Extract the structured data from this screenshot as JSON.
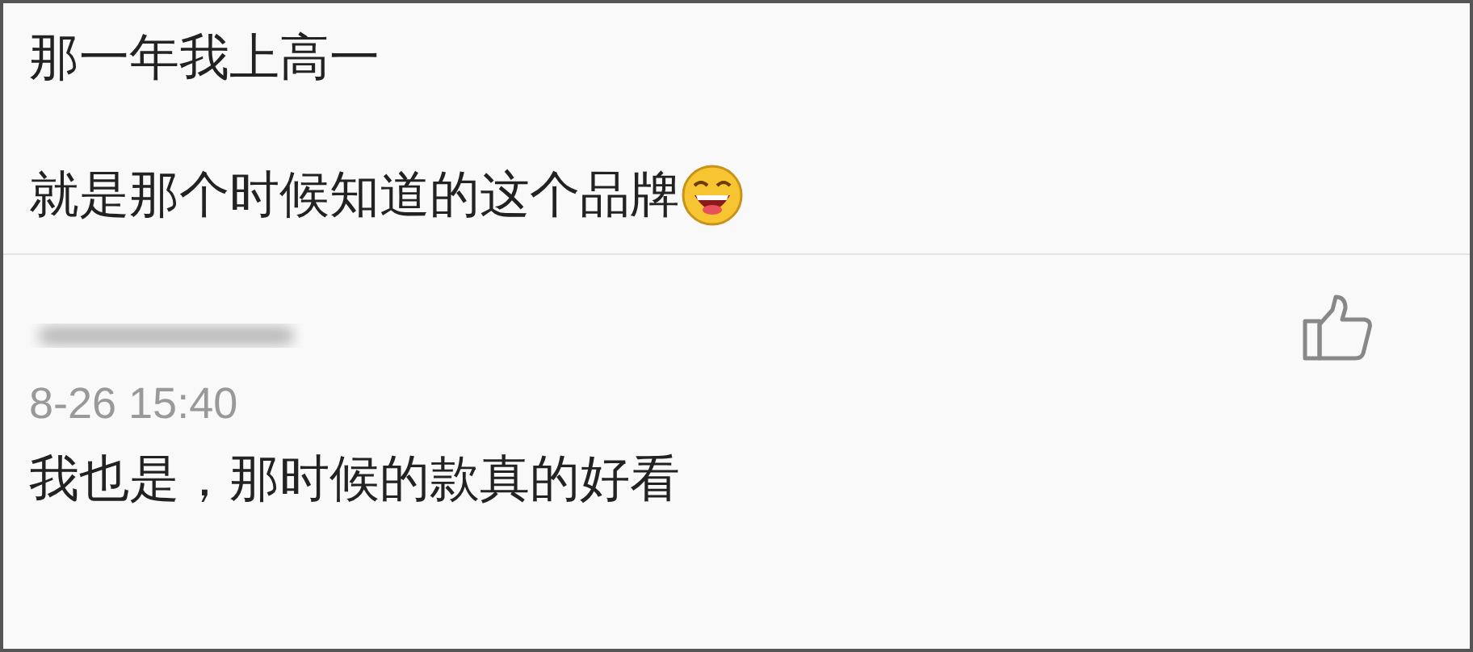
{
  "post": {
    "lines": [
      "那一年我上高一",
      "就是那个时候知道的这个品牌"
    ]
  },
  "reply": {
    "time": "8-26 15:40",
    "text": "我也是，那时候的款真的好看"
  }
}
